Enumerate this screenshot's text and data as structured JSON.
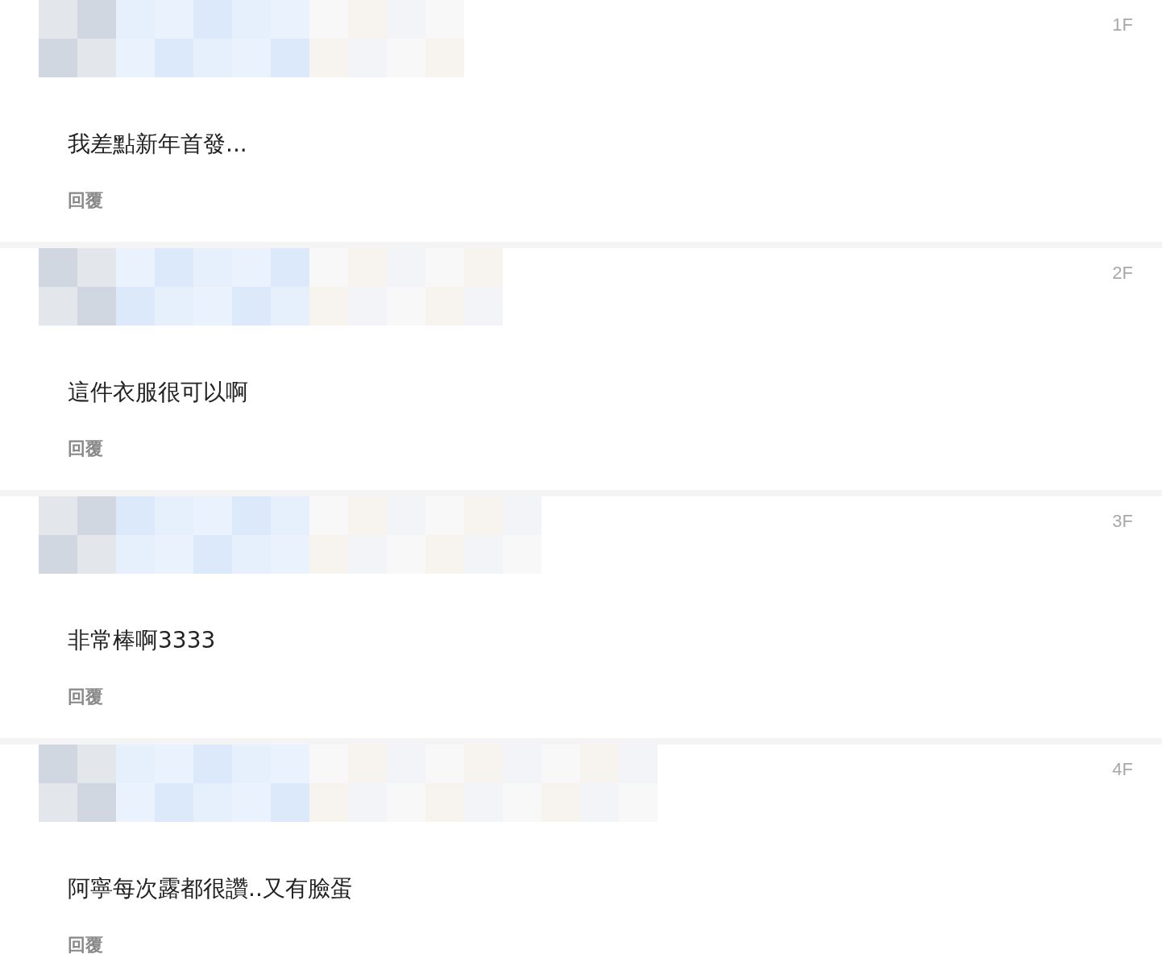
{
  "comments": [
    {
      "floor": "1F",
      "redacted": true,
      "text": "我差點新年首發...",
      "reply": "回覆"
    },
    {
      "floor": "2F",
      "redacted": true,
      "text": "這件衣服很可以啊",
      "reply": "回覆"
    },
    {
      "floor": "3F",
      "redacted": true,
      "text": "非常棒啊3333",
      "reply": "回覆"
    },
    {
      "floor": "4F",
      "redacted": true,
      "text": "阿寧每次露都很讚..又有臉蛋",
      "reply": "回覆"
    }
  ]
}
